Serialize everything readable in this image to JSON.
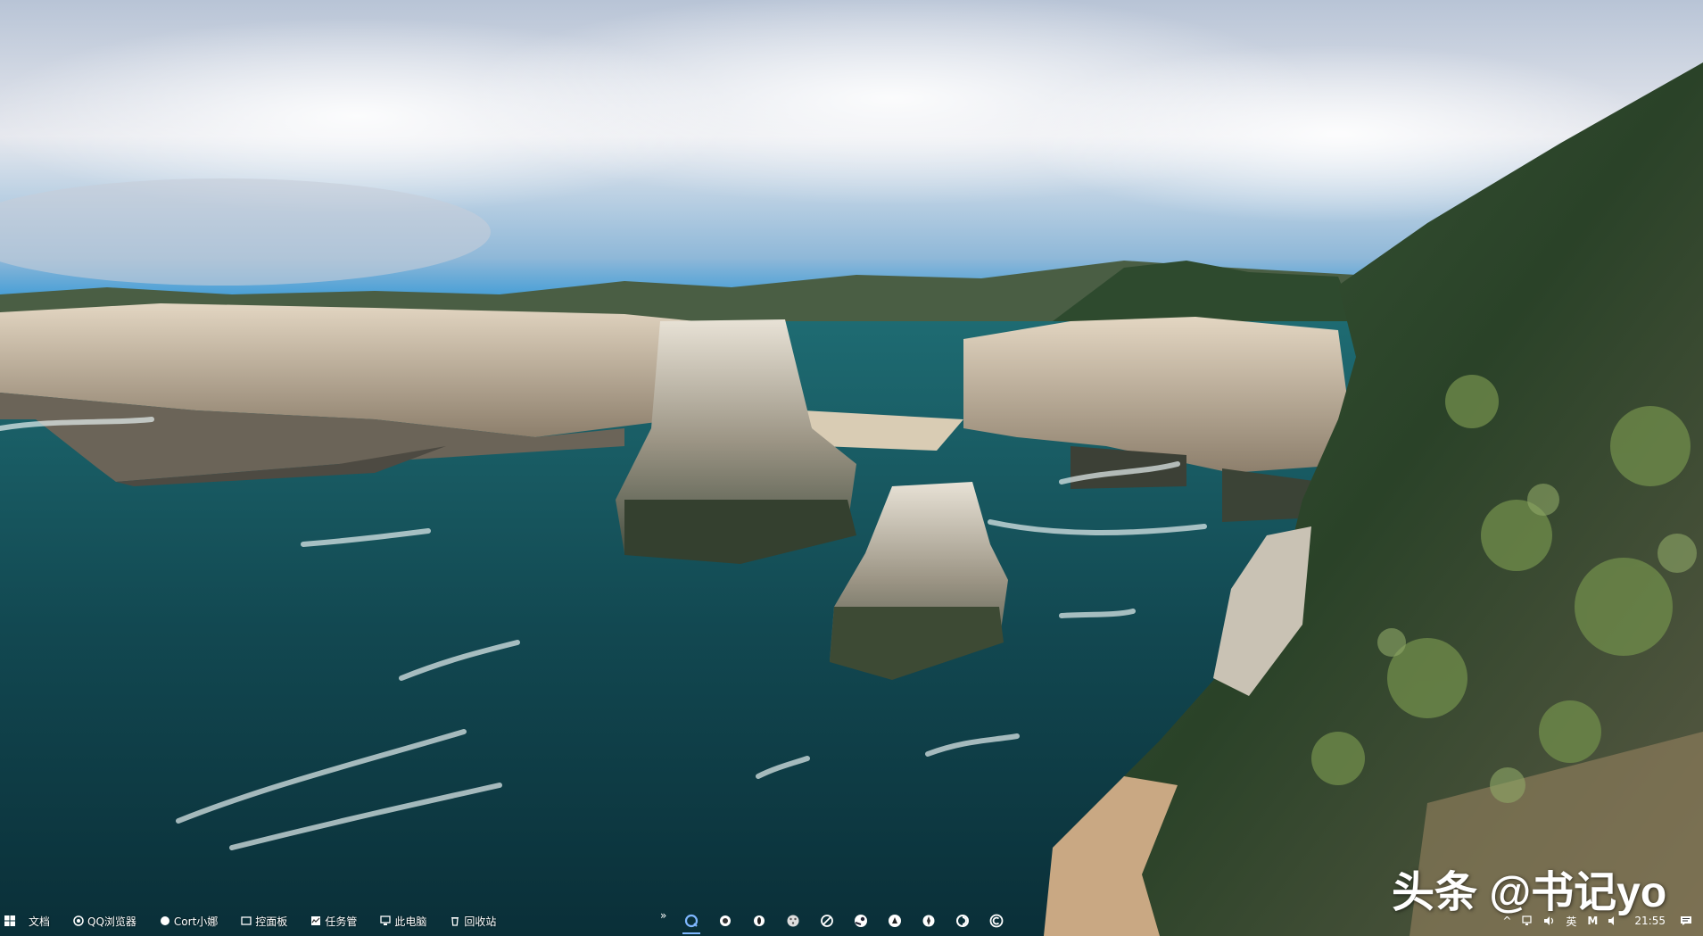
{
  "watermark": {
    "text": "头条 @书记yo"
  },
  "taskbar": {
    "quick_links": [
      {
        "label": "文档",
        "icon": "document-icon"
      },
      {
        "label": "QQ浏览器",
        "icon": "qq-browser-icon"
      },
      {
        "label": "Cort小娜",
        "icon": "cortana-icon"
      },
      {
        "label": "控面板",
        "icon": "control-panel-icon"
      },
      {
        "label": "任务管",
        "icon": "task-manager-icon"
      },
      {
        "label": "此电脑",
        "icon": "this-pc-icon"
      },
      {
        "label": "回收站",
        "icon": "recycle-bin-icon"
      }
    ],
    "overflow": "»",
    "pinned_apps": [
      {
        "icon": "search-app-icon",
        "active": true
      },
      {
        "icon": "circle-app-icon",
        "active": false
      },
      {
        "icon": "record-app-icon",
        "active": false
      },
      {
        "icon": "dots-app-icon",
        "active": false
      },
      {
        "icon": "slash-app-icon",
        "active": false
      },
      {
        "icon": "steam-icon",
        "active": false
      },
      {
        "icon": "bird-app-icon",
        "active": false
      },
      {
        "icon": "compass-app-icon",
        "active": false
      },
      {
        "icon": "swirl-app-icon",
        "active": false
      },
      {
        "icon": "c-circle-app-icon",
        "active": false
      }
    ],
    "tray": {
      "show_hidden": "^",
      "ime": "英",
      "mail": "M",
      "time": "21:55"
    }
  },
  "colors": {
    "sky_top": "#c9d4e4",
    "sky_blue": "#3a9ad6",
    "sea_dark": "#0d3a44",
    "sea_mid": "#17535c",
    "cliff": "#d8c8b0",
    "grass": "#2f4a2c",
    "accent": "#7fb7ff"
  }
}
